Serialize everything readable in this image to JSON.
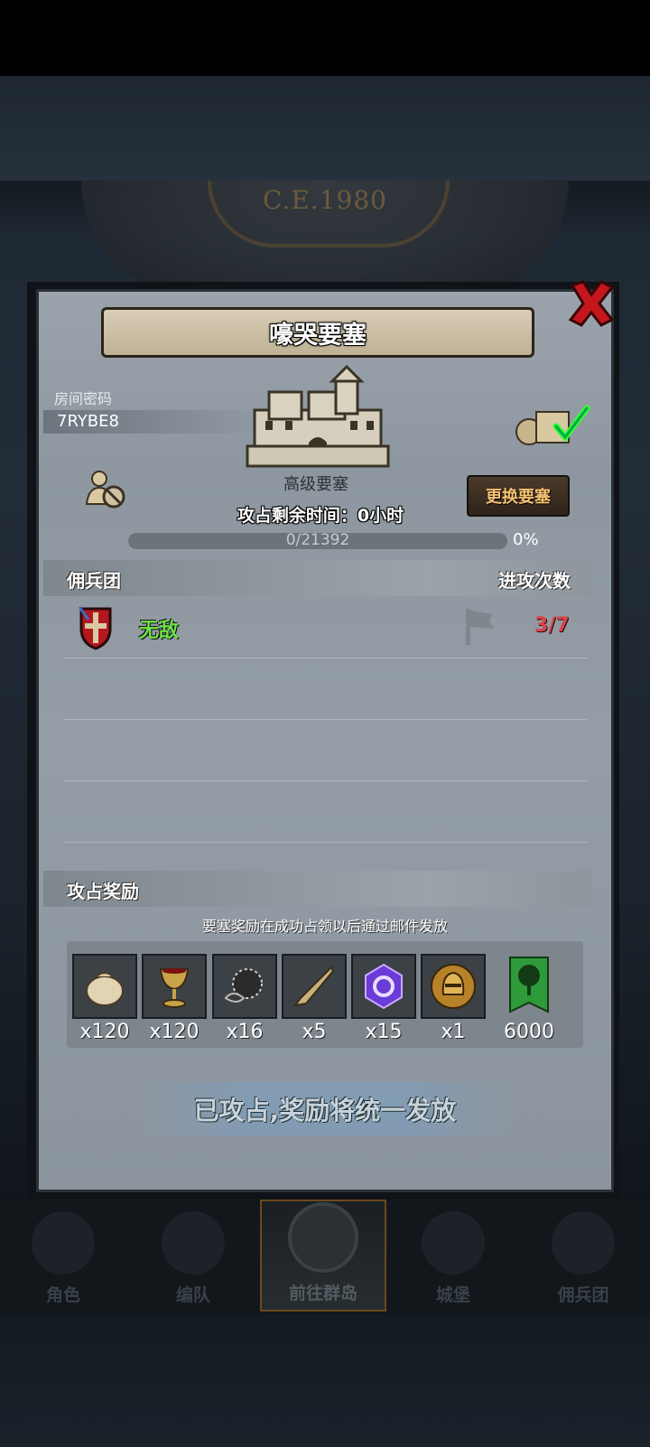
{
  "background": {
    "year": "C.E.1980"
  },
  "dialog": {
    "title": "嚎哭要塞",
    "room_label": "房间密码",
    "room_code": "7RYBE8",
    "fort_level": "高级要塞",
    "change_button": "更换要塞",
    "timer_text": "攻占剩余时间：0小时",
    "progress": {
      "text": "0/21392",
      "fraction": 0.0
    },
    "percent": "0%",
    "header_left": "佣兵团",
    "header_right": "进攻次数",
    "team": {
      "name": "无敌",
      "attacks": "3/7"
    },
    "rewards_title": "攻占奖励",
    "reward_note": "要塞奖励在成功占领以后通过邮件发放",
    "rewards": [
      {
        "icon": "sack-icon",
        "qty": "x120"
      },
      {
        "icon": "goblet-icon",
        "qty": "x120"
      },
      {
        "icon": "ore-icon",
        "qty": "x16"
      },
      {
        "icon": "horn-icon",
        "qty": "x5"
      },
      {
        "icon": "crystal-icon",
        "qty": "x15"
      },
      {
        "icon": "helmet-coin-icon",
        "qty": "x1"
      },
      {
        "icon": "tree-banner-icon",
        "qty": "6000"
      }
    ],
    "claim_text": "已攻占,奖励将统一发放"
  },
  "nav": {
    "items": [
      {
        "label": "角色",
        "icon": "knight-icon"
      },
      {
        "label": "编队",
        "icon": "helmet-icon"
      },
      {
        "label": "前往群岛",
        "icon": "island-icon",
        "active": true
      },
      {
        "label": "城堡",
        "icon": "castle-icon"
      },
      {
        "label": "佣兵团",
        "icon": "guild-icon"
      }
    ]
  }
}
